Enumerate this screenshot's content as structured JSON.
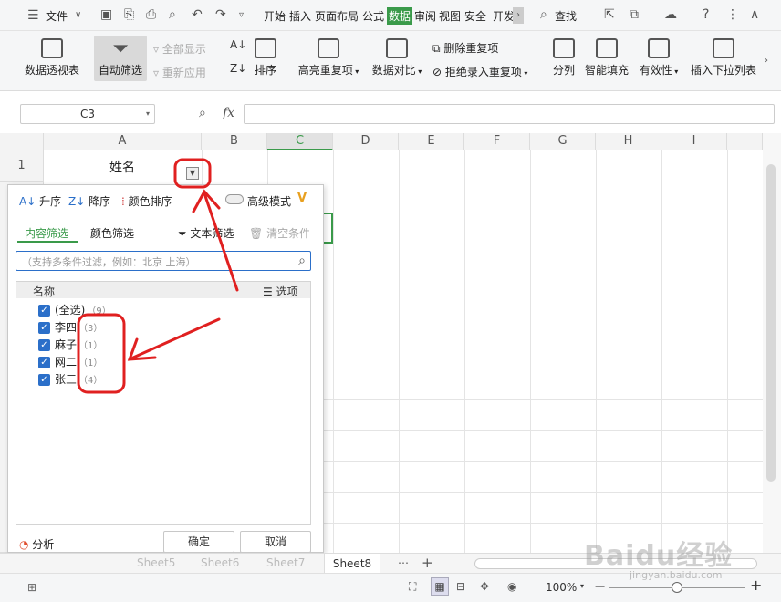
{
  "menubar": {
    "file": "文件",
    "tabs": [
      "开始",
      "插入",
      "页面布局",
      "公式",
      "数据",
      "审阅",
      "视图",
      "安全",
      "开发"
    ],
    "search": "查找"
  },
  "ribbon": {
    "pivot": "数据透视表",
    "autofilter": "自动筛选",
    "show_all": "全部显示",
    "reapply": "重新应用",
    "sort": "排序",
    "highlight_dup": "高亮重复项",
    "compare": "数据对比",
    "delete_dup": "删除重复项",
    "reject_dup": "拒绝录入重复项",
    "split": "分列",
    "smart_fill": "智能填充",
    "validity": "有效性",
    "dropdown": "插入下拉列表"
  },
  "formula": {
    "namebox": "C3",
    "fx": "fx",
    "value": ""
  },
  "columns": [
    "A",
    "B",
    "C",
    "D",
    "E",
    "F",
    "G",
    "H",
    "I"
  ],
  "rows": [
    "1"
  ],
  "cells": {
    "A1": "姓名"
  },
  "filter": {
    "asc": "升序",
    "desc": "降序",
    "color_sort": "颜色排序",
    "advanced": "高级模式",
    "tab_content": "内容筛选",
    "tab_color": "颜色筛选",
    "text_filter": "文本筛选",
    "clear": "清空条件",
    "search_placeholder": "（支持多条件过滤，例如：北京 上海）",
    "list_header": "名称",
    "options": "选项",
    "items": [
      {
        "label": "(全选)",
        "count": "（9）"
      },
      {
        "label": "李四",
        "count": "（3）"
      },
      {
        "label": "麻子",
        "count": "（1）"
      },
      {
        "label": "网二",
        "count": "（1）"
      },
      {
        "label": "张三",
        "count": "（4）"
      }
    ],
    "analysis": "分析",
    "ok": "确定",
    "cancel": "取消"
  },
  "sheetbar": {
    "sheets": [
      "Sheet5",
      "Sheet6",
      "Sheet7",
      "Sheet8"
    ]
  },
  "status": {
    "zoom": "100%"
  },
  "watermark": "Baidu经验",
  "watermark_url": "jingyan.baidu.com",
  "colors": {
    "accent": "#3a9a4a",
    "annotation": "#e02020",
    "checkbox": "#2b6fc9"
  }
}
